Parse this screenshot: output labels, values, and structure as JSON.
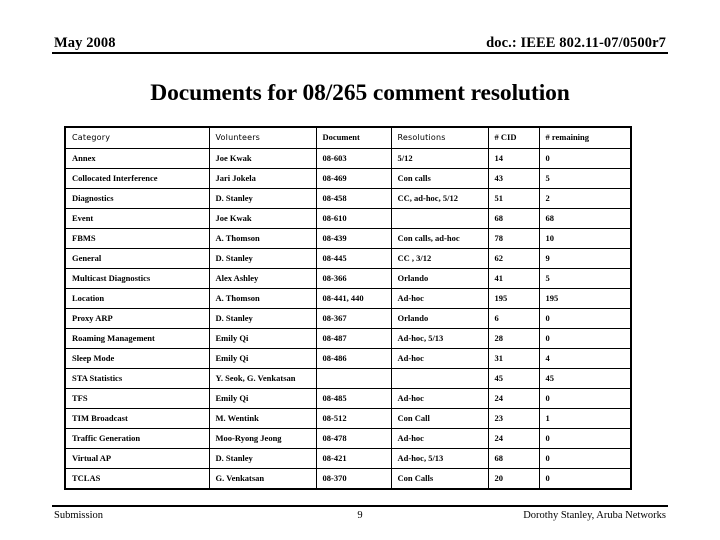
{
  "header": {
    "date": "May 2008",
    "doc_id": "doc.: IEEE 802.11-07/0500r7"
  },
  "title": "Documents for 08/265 comment resolution",
  "table": {
    "columns": [
      {
        "label": "Category",
        "style": "sans"
      },
      {
        "label": "Volunteers",
        "style": "sans"
      },
      {
        "label": "Document",
        "style": "serif"
      },
      {
        "label": "Resolutions",
        "style": "sans"
      },
      {
        "label": "# CID",
        "style": "serif"
      },
      {
        "label": "# remaining",
        "style": "serif"
      }
    ],
    "rows": [
      {
        "category": "Annex",
        "volunteers": "Joe Kwak",
        "document": "08-603",
        "resolutions": "5/12",
        "cid": "14",
        "remaining": "0"
      },
      {
        "category": "Collocated Interference",
        "volunteers": "Jari Jokela",
        "document": "08-469",
        "resolutions": "Con calls",
        "cid": "43",
        "remaining": "5"
      },
      {
        "category": "Diagnostics",
        "volunteers": "D. Stanley",
        "document": "08-458",
        "resolutions": "CC, ad-hoc, 5/12",
        "cid": "51",
        "remaining": "2"
      },
      {
        "category": "Event",
        "volunteers": "Joe Kwak",
        "document": "08-610",
        "resolutions": "",
        "cid": "68",
        "remaining": "68"
      },
      {
        "category": "FBMS",
        "volunteers": "A. Thomson",
        "document": "08-439",
        "resolutions": "Con calls, ad-hoc",
        "cid": "78",
        "remaining": "10"
      },
      {
        "category": "General",
        "volunteers": "D. Stanley",
        "document": "08-445",
        "resolutions": "CC , 3/12",
        "cid": "62",
        "remaining": "9"
      },
      {
        "category": "Multicast Diagnostics",
        "volunteers": "Alex Ashley",
        "document": "08-366",
        "resolutions": "Orlando",
        "cid": "41",
        "remaining": "5"
      },
      {
        "category": "Location",
        "volunteers": "A. Thomson",
        "document": "08-441, 440",
        "resolutions": "Ad-hoc",
        "cid": "195",
        "remaining": "195"
      },
      {
        "category": "Proxy ARP",
        "volunteers": "D. Stanley",
        "document": "08-367",
        "resolutions": "Orlando",
        "cid": "6",
        "remaining": "0"
      },
      {
        "category": "Roaming Management",
        "volunteers": "Emily Qi",
        "document": "08-487",
        "resolutions": "Ad-hoc, 5/13",
        "cid": "28",
        "remaining": "0"
      },
      {
        "category": "Sleep Mode",
        "volunteers": "Emily Qi",
        "document": "08-486",
        "resolutions": "Ad-hoc",
        "cid": "31",
        "remaining": "4"
      },
      {
        "category": "STA Statistics",
        "volunteers": "Y. Seok, G. Venkatsan",
        "document": "",
        "resolutions": "",
        "cid": "45",
        "remaining": "45"
      },
      {
        "category": "TFS",
        "volunteers": "Emily Qi",
        "document": "08-485",
        "resolutions": "Ad-hoc",
        "cid": "24",
        "remaining": "0"
      },
      {
        "category": "TIM Broadcast",
        "volunteers": "M. Wentink",
        "document": "08-512",
        "resolutions": "Con Call",
        "cid": "23",
        "remaining": "1"
      },
      {
        "category": "Traffic Generation",
        "volunteers": "Moo-Ryong Jeong",
        "document": "08-478",
        "resolutions": "Ad-hoc",
        "cid": "24",
        "remaining": "0"
      },
      {
        "category": "Virtual AP",
        "volunteers": "D. Stanley",
        "document": "08-421",
        "resolutions": "Ad-hoc, 5/13",
        "cid": "68",
        "remaining": "0"
      },
      {
        "category": "TCLAS",
        "volunteers": "G. Venkatsan",
        "document": "08-370",
        "resolutions": "Con Calls",
        "cid": "20",
        "remaining": "0"
      }
    ]
  },
  "footer": {
    "left": "Submission",
    "page_number": "9",
    "right": "Dorothy Stanley, Aruba Networks"
  }
}
